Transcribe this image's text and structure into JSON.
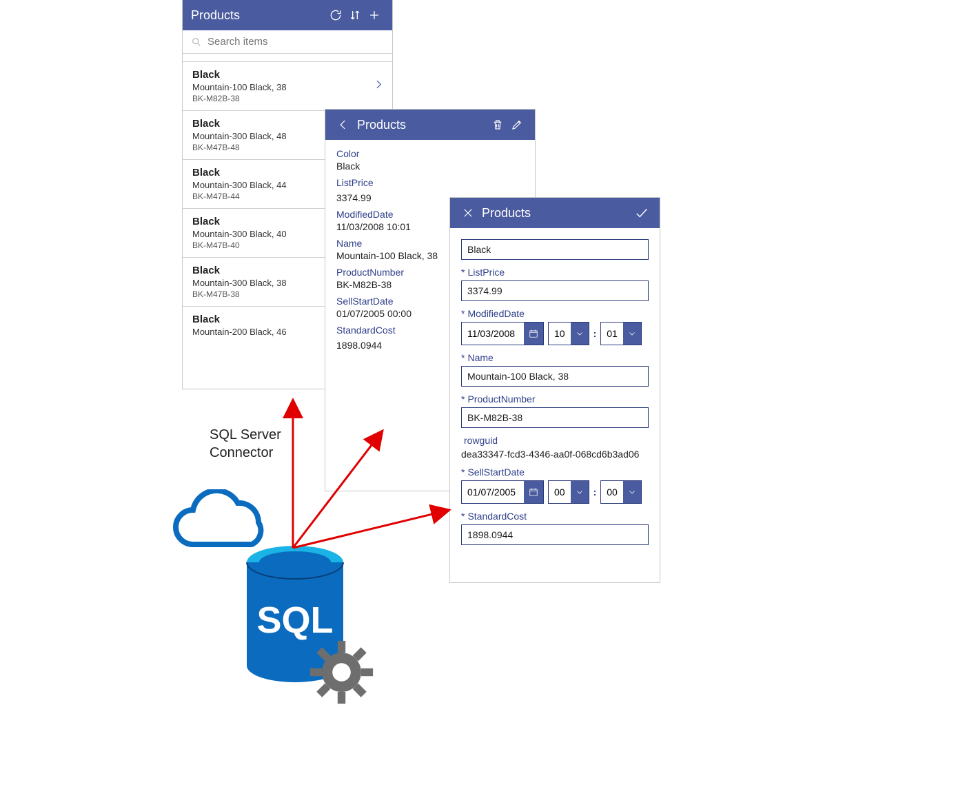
{
  "list": {
    "title": "Products",
    "search_placeholder": "Search items",
    "items": [
      {
        "color": "Black",
        "name": "Mountain-100 Black, 38",
        "sku": "BK-M82B-38",
        "selected": true
      },
      {
        "color": "Black",
        "name": "Mountain-300 Black, 48",
        "sku": "BK-M47B-48"
      },
      {
        "color": "Black",
        "name": "Mountain-300 Black, 44",
        "sku": "BK-M47B-44"
      },
      {
        "color": "Black",
        "name": "Mountain-300 Black, 40",
        "sku": "BK-M47B-40"
      },
      {
        "color": "Black",
        "name": "Mountain-300 Black, 38",
        "sku": "BK-M47B-38"
      },
      {
        "color": "Black",
        "name": "Mountain-200 Black, 46",
        "sku": ""
      }
    ]
  },
  "detail": {
    "title": "Products",
    "fields": {
      "Color": "Black",
      "ListPrice": "3374.99",
      "ModifiedDate": "11/03/2008 10:01",
      "Name": "Mountain-100 Black, 38",
      "ProductNumber": "BK-M82B-38",
      "SellStartDate": "01/07/2005 00:00",
      "StandardCost": "1898.0944"
    },
    "labels": {
      "color": "Color",
      "listprice": "ListPrice",
      "modified": "ModifiedDate",
      "name": "Name",
      "productnum": "ProductNumber",
      "sellstart": "SellStartDate",
      "stdcost": "StandardCost"
    }
  },
  "edit": {
    "title": "Products",
    "color": "Black",
    "listprice_label": "ListPrice",
    "listprice": "3374.99",
    "modified_label": "ModifiedDate",
    "modified_date": "11/03/2008",
    "modified_h": "10",
    "modified_m": "01",
    "name_label": "Name",
    "name": "Mountain-100 Black, 38",
    "productnum_label": "ProductNumber",
    "productnum": "BK-M82B-38",
    "rowguid_label": "rowguid",
    "rowguid": "dea33347-fcd3-4346-aa0f-068cd6b3ad06",
    "sellstart_label": "SellStartDate",
    "sellstart_date": "01/07/2005",
    "sellstart_h": "00",
    "sellstart_m": "00",
    "stdcost_label": "StandardCost",
    "stdcost": "1898.0944",
    "star": "*"
  },
  "connector_label_line1": "SQL Server",
  "connector_label_line2": "Connector",
  "sql_glyph": "SQL"
}
